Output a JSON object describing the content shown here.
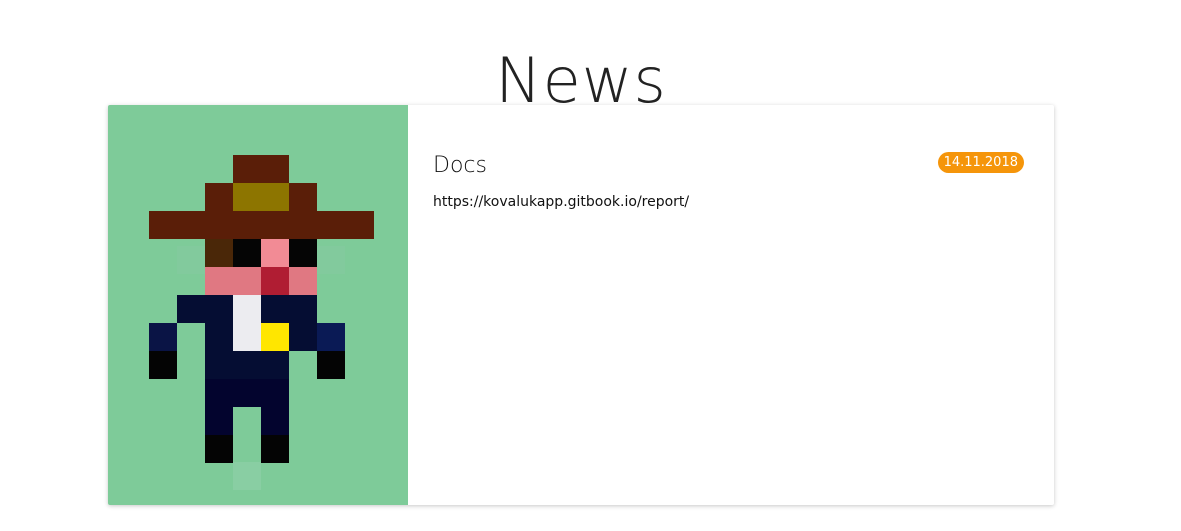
{
  "page": {
    "title": "News"
  },
  "news": [
    {
      "title": "Docs",
      "link": "https://kovalukapp.gitbook.io/report/",
      "date": "14.11.2018",
      "image": {
        "icon": "pixel-art-cowboy-avatar",
        "background_color": "#7ecb99"
      }
    }
  ],
  "colors": {
    "badge": "#f5950a",
    "hat": "#5a1e08",
    "hat_band": "#8d7500",
    "skin": "#e07882",
    "suit": "#050d33"
  }
}
